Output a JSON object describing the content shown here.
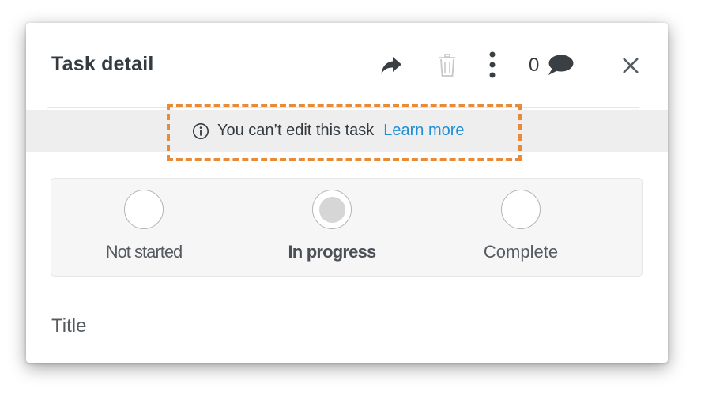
{
  "header": {
    "title": "Task detail",
    "comment_count": "0",
    "icons": [
      "share-icon",
      "trash-icon",
      "more-vertical-icon",
      "comment-icon",
      "close-icon"
    ]
  },
  "notice": {
    "message": "You can’t edit this task",
    "link_label": "Learn more",
    "icon": "info-icon"
  },
  "status": {
    "options": [
      {
        "label": "Not started",
        "selected": false
      },
      {
        "label": "In progress",
        "selected": true
      },
      {
        "label": "Complete",
        "selected": false
      }
    ]
  },
  "fields": {
    "title_label": "Title"
  },
  "colors": {
    "link": "#1f8fd6",
    "highlight": "#e98a37",
    "notice_bg": "#eeeeee",
    "text": "#333a40"
  }
}
